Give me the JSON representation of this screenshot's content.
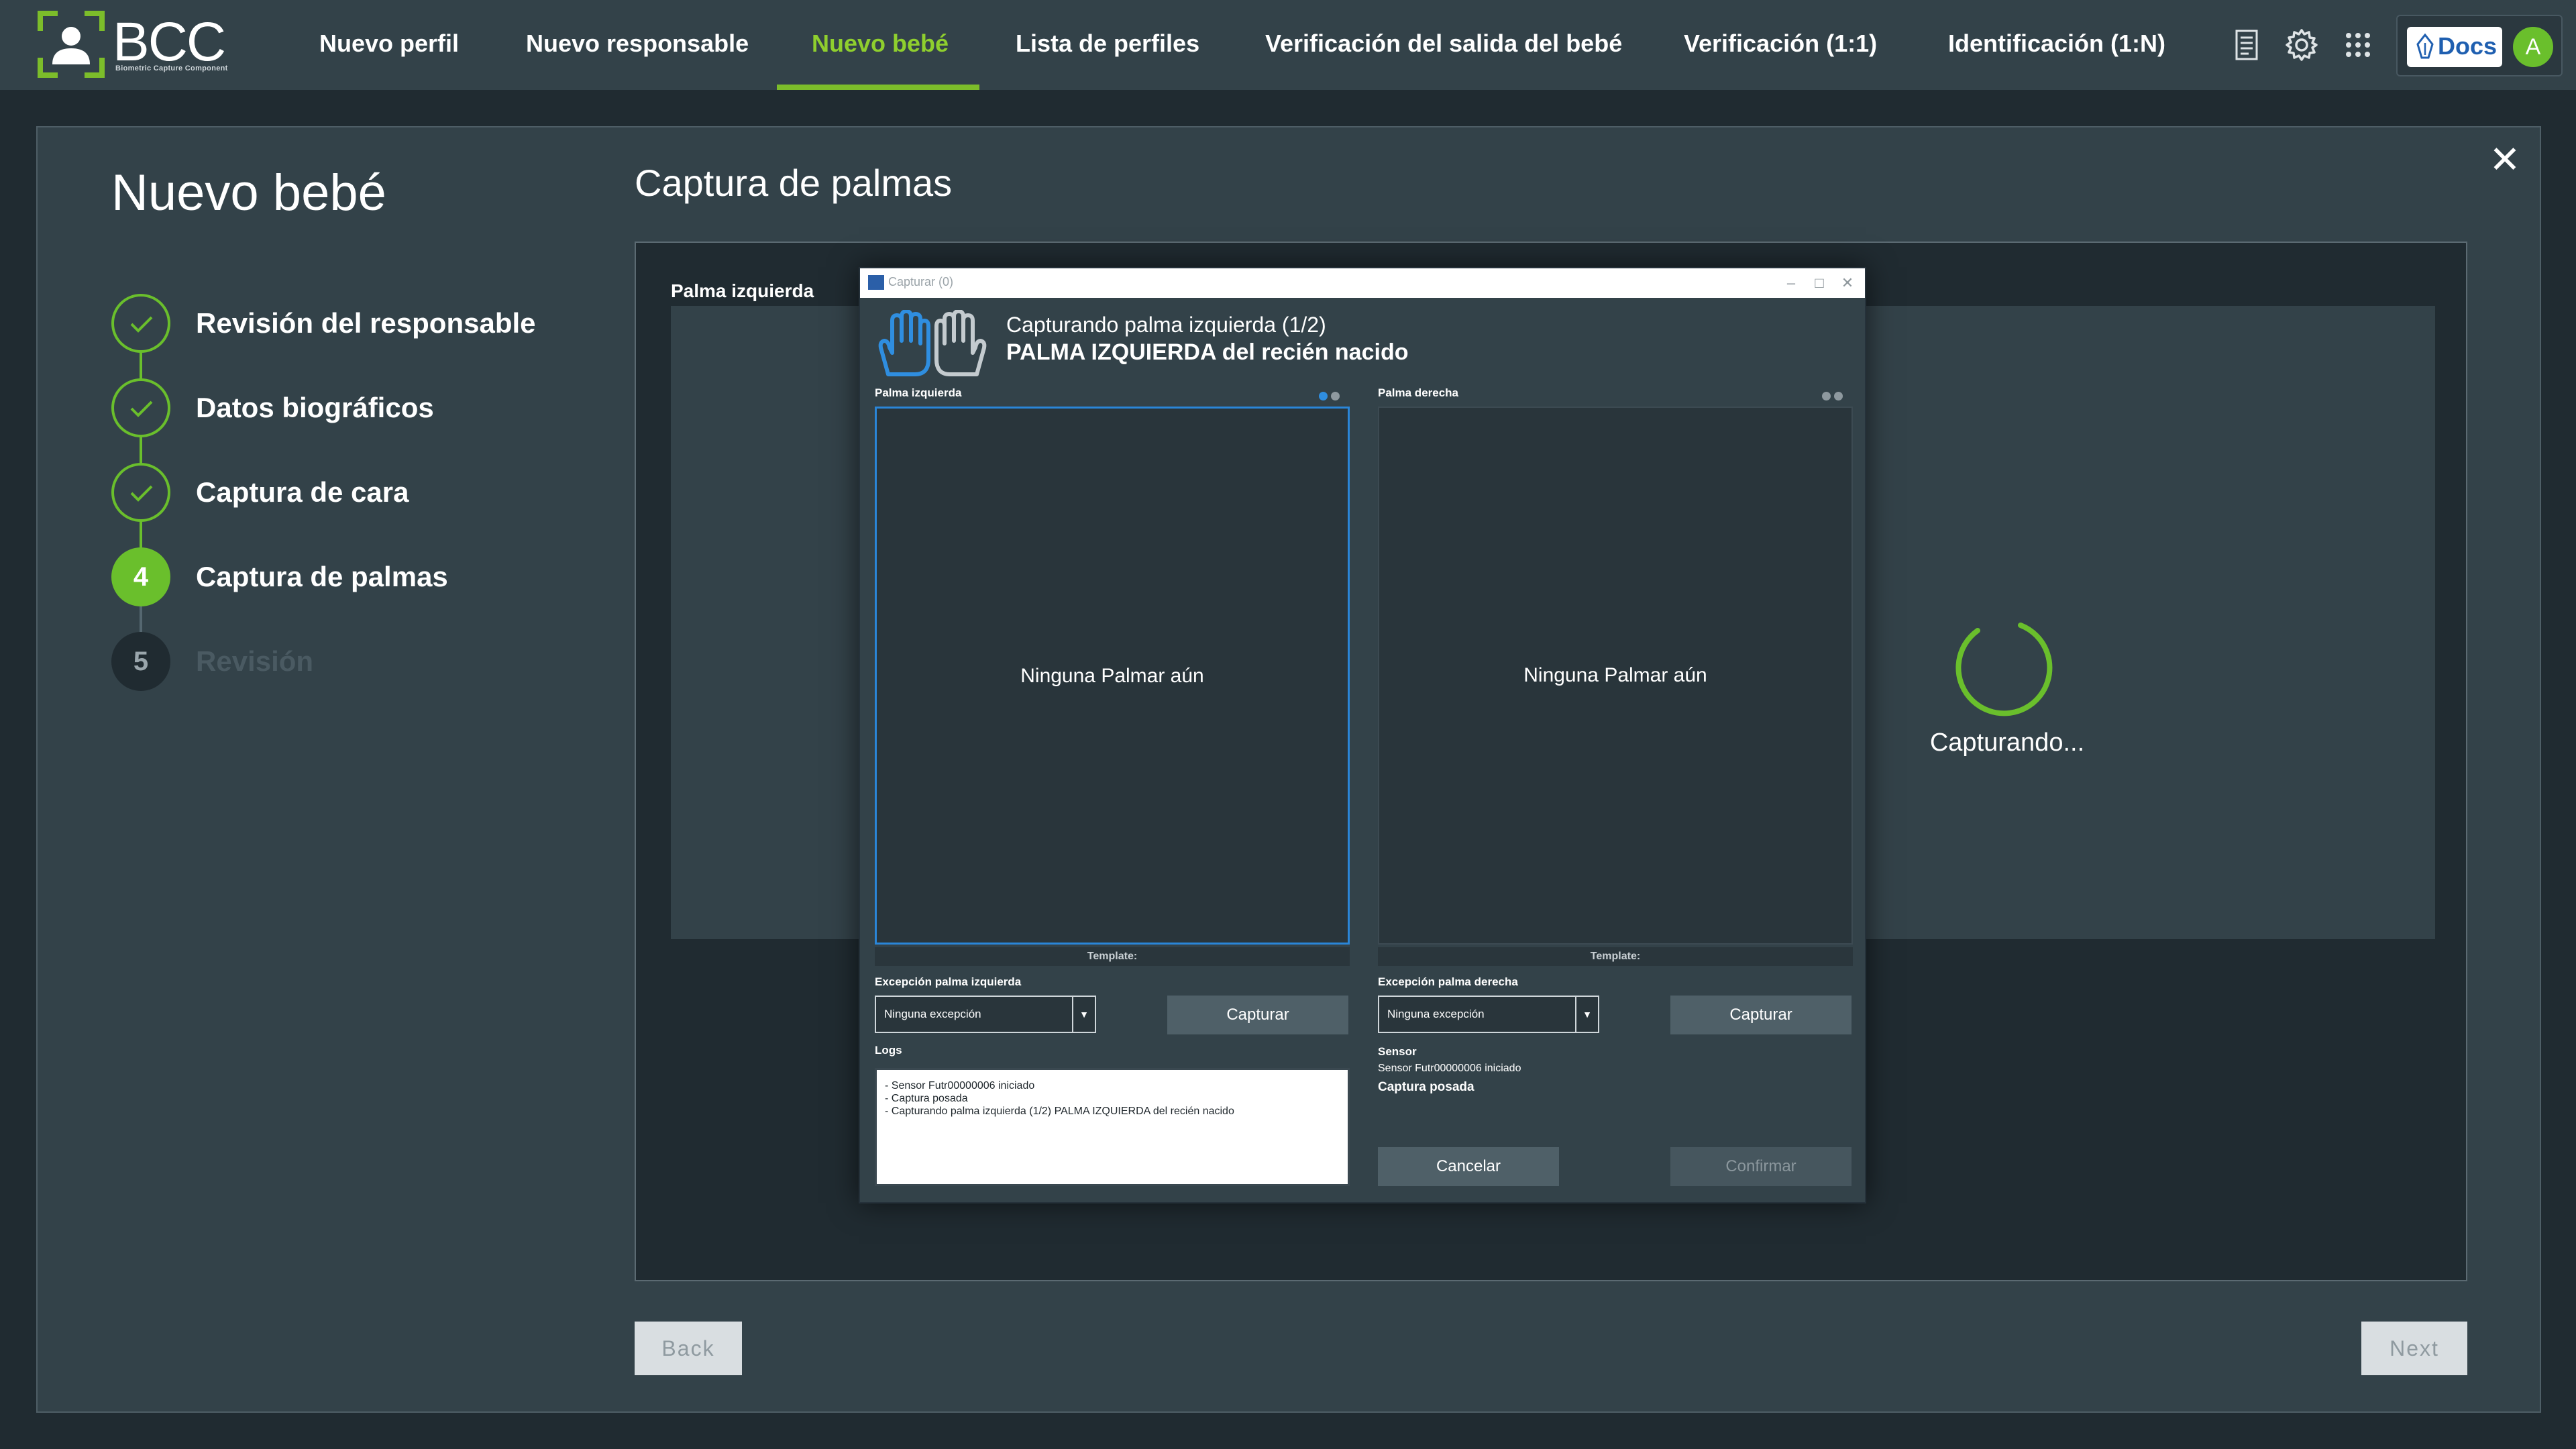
{
  "app": {
    "logo_text": "BCC",
    "logo_subtitle": "Biometric Capture Component"
  },
  "nav": {
    "items": [
      {
        "label": "Nuevo perfil"
      },
      {
        "label": "Nuevo responsable"
      },
      {
        "label": "Nuevo bebé",
        "active": true
      },
      {
        "label": "Lista de perfiles"
      },
      {
        "label": "Verificación del salida del bebé"
      },
      {
        "label": "Verificación (1:1)"
      },
      {
        "label": "Identificación (1:N)"
      }
    ],
    "icons": [
      "document-list-icon",
      "settings-gear-icon",
      "apps-grid-icon"
    ],
    "docs_label": "Docs",
    "avatar_initial": "A"
  },
  "wizard": {
    "title": "Nuevo bebé",
    "steps": [
      {
        "number": "1",
        "label": "Revisión del responsable",
        "state": "done"
      },
      {
        "number": "2",
        "label": "Datos biográficos",
        "state": "done"
      },
      {
        "number": "3",
        "label": "Captura de cara",
        "state": "done"
      },
      {
        "number": "4",
        "label": "Captura de palmas",
        "state": "current"
      },
      {
        "number": "5",
        "label": "Revisión",
        "state": "pending"
      }
    ],
    "section_title": "Captura de palmas",
    "content_label": "Palma izquierda",
    "status_text": "Capturando...",
    "back_label": "Back",
    "next_label": "Next"
  },
  "modal": {
    "window_title": "Capturar (0)",
    "subtitle": "Capturando palma izquierda (1/2)",
    "main_text": "PALMA IZQUIERDA del recién nacido",
    "left_pane": {
      "label": "Palma izquierda",
      "empty_text": "Ninguna Palmar aún",
      "template_label": "Template:",
      "exception_label": "Excepción palma izquierda",
      "exception_value": "Ninguna excepción",
      "capture_label": "Capturar"
    },
    "right_pane": {
      "label": "Palma derecha",
      "empty_text": "Ninguna Palmar aún",
      "template_label": "Template:",
      "exception_label": "Excepción palma derecha",
      "exception_value": "Ninguna excepción",
      "capture_label": "Capturar"
    },
    "logs_label": "Logs",
    "logs": [
      "- Sensor Futr00000006 iniciado",
      "- Captura posada",
      "- Capturando palma izquierda (1/2) PALMA IZQUIERDA del recién nacido"
    ],
    "sensor_label": "Sensor",
    "sensor_line": "Sensor Futr00000006 iniciado",
    "sensor_status": "Captura posada",
    "cancel_label": "Cancelar",
    "confirm_label": "Confirmar"
  },
  "colors": {
    "accent": "#7cbd2a",
    "background": "#202b31",
    "panel": "#334249",
    "selection": "#2a86d8"
  }
}
